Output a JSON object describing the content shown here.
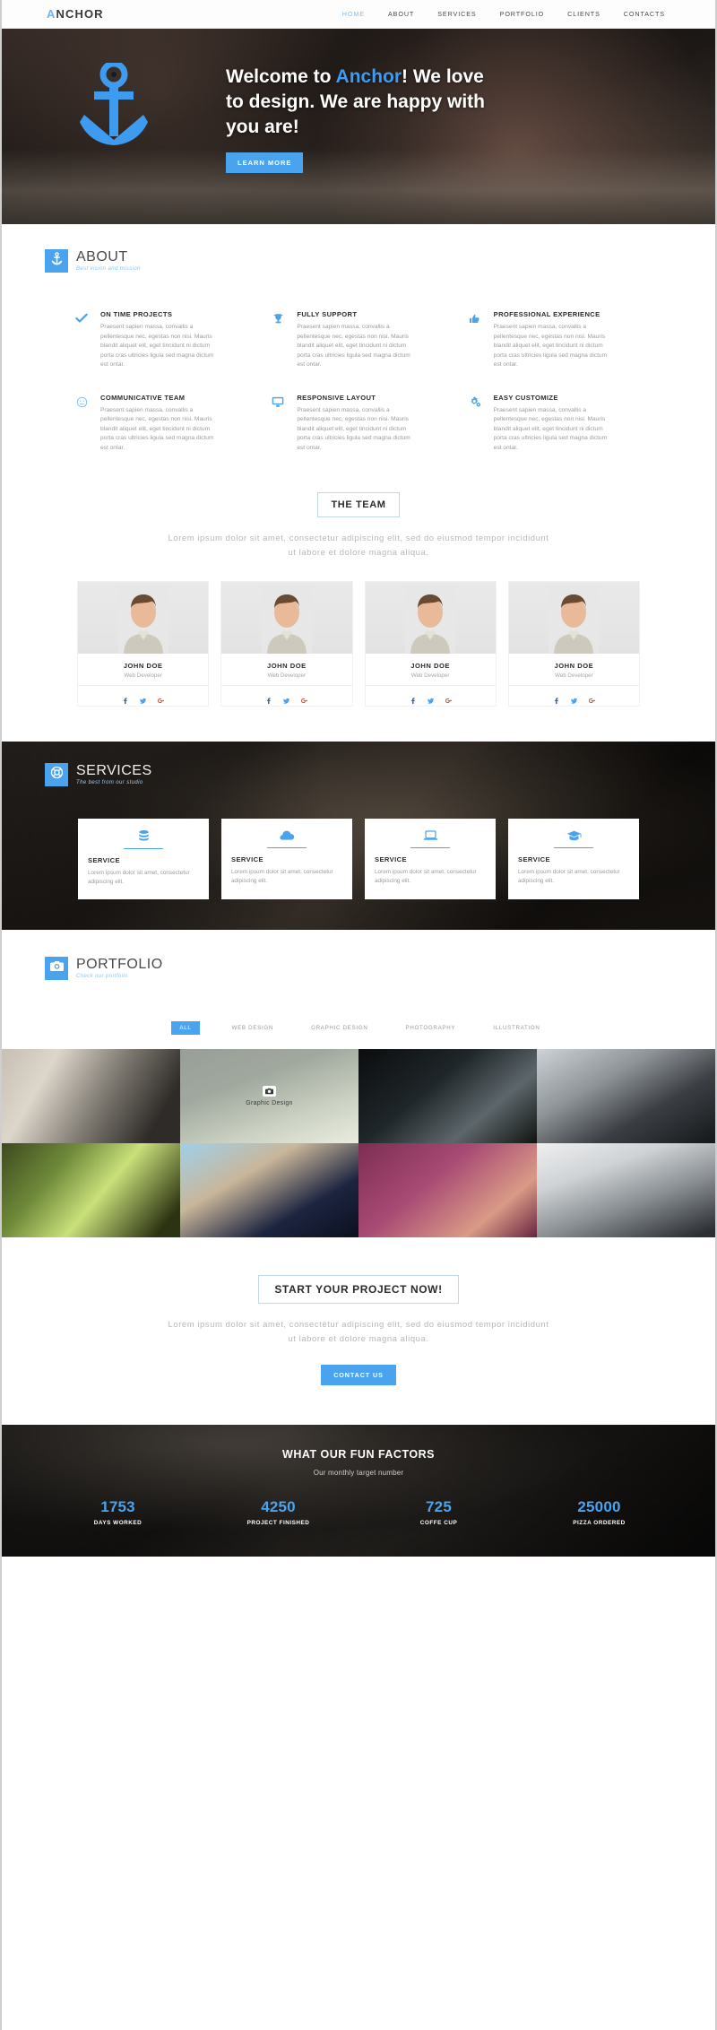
{
  "nav": {
    "brand_accent": "A",
    "brand_rest": "NCHOR",
    "links": [
      {
        "label": "HOME",
        "active": true
      },
      {
        "label": "ABOUT",
        "active": false
      },
      {
        "label": "SERVICES",
        "active": false
      },
      {
        "label": "PORTFOLIO",
        "active": false
      },
      {
        "label": "CLIENTS",
        "active": false
      },
      {
        "label": "CONTACTS",
        "active": false
      }
    ]
  },
  "hero": {
    "logo_icon": "anchor-icon",
    "title_pre": "Welcome to ",
    "title_accent": "Anchor",
    "title_post": "! We love to design. We are happy with you are!",
    "cta_label": "LEARN MORE"
  },
  "about": {
    "badge_icon": "anchor-icon",
    "title": "ABOUT",
    "subtitle": "Best vision and mission",
    "features": [
      {
        "icon": "check-icon",
        "title": "ON TIME PROJECTS",
        "body": "Praesent sapien massa, convallis a pellentesque nec, egestas non nisi. Mauris blandit aliquet elit, eget tincidunt ni dictum porta cras ultricies ligula sed magna dictum est ontar."
      },
      {
        "icon": "trophy-icon",
        "title": "FULLY SUPPORT",
        "body": "Praesent sapien massa, convallis a pellentesque nec, egestas non nisi. Mauris blandit aliquet elit, eget tincidunt ni dictum porta cras ultricies ligula sed magna dictum est ontar."
      },
      {
        "icon": "thumbs-up-icon",
        "title": "PROFESSIONAL EXPERIENCE",
        "body": "Praesent sapien massa, convallis a pellentesque nec, egestas non nisi. Mauris blandit aliquet elit, eget tincidunt ni dictum porta cras ultricies ligula sed magna dictum est ontar."
      },
      {
        "icon": "smiley-icon",
        "title": "COMMUNICATIVE TEAM",
        "body": "Praesent sapien massa, convallis a pellentesque nec, egestas non nisi. Mauris blandit aliquet elit, eget tincidunt ni dictum porta cras ultricies ligula sed magna dictum est ontar."
      },
      {
        "icon": "monitor-icon",
        "title": "RESPONSIVE LAYOUT",
        "body": "Praesent sapien massa, convallis a pellentesque nec, egestas non nisi. Mauris blandit aliquet elit, eget tincidunt ni dictum porta cras ultricies ligula sed magna dictum est ontar."
      },
      {
        "icon": "gears-icon",
        "title": "EASY CUSTOMIZE",
        "body": "Praesent sapien massa, convallis a pellentesque nec, egestas non nisi. Mauris blandit aliquet elit, eget tincidunt ni dictum porta cras ultricies ligula sed magna dictum est ontar."
      }
    ]
  },
  "team": {
    "title": "THE TEAM",
    "lead": "Lorem ipsum dolor sit amet, consectetur adipiscing elit, sed do eiusmod tempor incididunt ut labore et dolore magna aliqua.",
    "members": [
      {
        "name": "JOHN DOE",
        "role": "Web Developer"
      },
      {
        "name": "JOHN DOE",
        "role": "Web Developer"
      },
      {
        "name": "JOHN DOE",
        "role": "Web Developer"
      },
      {
        "name": "JOHN DOE",
        "role": "Web Developer"
      }
    ],
    "social_icons": [
      "facebook-icon",
      "twitter-icon",
      "google-plus-icon"
    ]
  },
  "services": {
    "badge_icon": "lifebuoy-icon",
    "title": "SERVICES",
    "subtitle": "The best from our studio",
    "cards": [
      {
        "icon": "database-icon",
        "name": "SERVICE",
        "body": "Lorem ipsum dolor sit amet, consectetur adipiscing elit."
      },
      {
        "icon": "cloud-icon",
        "name": "SERVICE",
        "body": "Lorem ipsum dolor sit amet, consectetur adipiscing elit."
      },
      {
        "icon": "laptop-icon",
        "name": "SERVICE",
        "body": "Lorem ipsum dolor sit amet, consectetur adipiscing elit."
      },
      {
        "icon": "graduation-cap-icon",
        "name": "SERVICE",
        "body": "Lorem ipsum dolor sit amet, consectetur adipiscing elit."
      }
    ]
  },
  "portfolio": {
    "badge_icon": "camera-icon",
    "title": "PORTFOLIO",
    "subtitle": "Check our portfolio",
    "filters": [
      {
        "label": "ALL",
        "active": true
      },
      {
        "label": "WEB DESIGN",
        "active": false
      },
      {
        "label": "GRAPHIC DESIGN",
        "active": false
      },
      {
        "label": "PHOTOGRAPHY",
        "active": false
      },
      {
        "label": "ILLUSTRATION",
        "active": false
      }
    ],
    "items": [
      {
        "alt": "desk-with-mug-and-camera",
        "overlay": null
      },
      {
        "alt": "hand-holding-phone-outdoors",
        "overlay": "Graphic Design"
      },
      {
        "alt": "car-speedometer-dashboard",
        "overlay": null
      },
      {
        "alt": "two-hands-with-smartphones",
        "overlay": null
      },
      {
        "alt": "soap-bubble-in-grass",
        "overlay": null
      },
      {
        "alt": "woman-in-sun-hat-by-canal",
        "overlay": null
      },
      {
        "alt": "person-in-pink-knit-hat",
        "overlay": null
      },
      {
        "alt": "hand-holding-white-iphone",
        "overlay": null
      }
    ]
  },
  "cta": {
    "title": "START YOUR PROJECT NOW!",
    "lead": "Lorem ipsum dolor sit amet, consectetur adipiscing elit, sed do eiusmod tempor incididunt ut labore et dolore magna aliqua.",
    "button_label": "CONTACT US"
  },
  "counters": {
    "title": "WHAT OUR FUN FACTORS",
    "subtitle": "Our monthly target number",
    "items": [
      {
        "value": "1753",
        "label": "DAYS WORKED"
      },
      {
        "value": "4250",
        "label": "PROJECT FINISHED"
      },
      {
        "value": "725",
        "label": "COFFE CUP"
      },
      {
        "value": "25000",
        "label": "PIZZA ORDERED"
      }
    ]
  },
  "colors": {
    "accent": "#4aa3ef",
    "accent_light": "#7cc0f7",
    "dark": "#2c2c2c",
    "muted": "#9b9b9b"
  }
}
